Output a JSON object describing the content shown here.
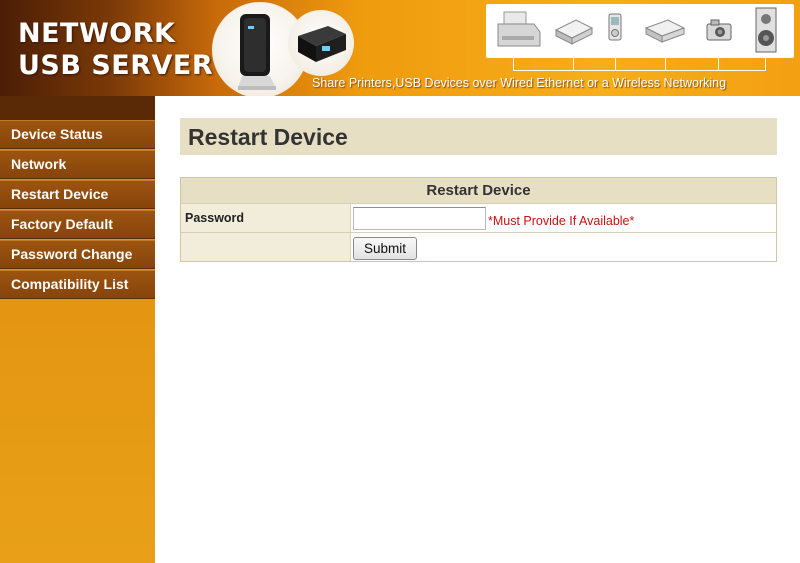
{
  "header": {
    "brand_line1": "NETWORK",
    "brand_line2": "USB SERVER",
    "tagline": "Share Printers,USB Devices over Wired Ethernet or a Wireless Networking",
    "device_icons": [
      "printer-icon",
      "scanner-icon",
      "media-player-icon",
      "external-drive-icon",
      "camera-icon",
      "speaker-icon"
    ]
  },
  "sidebar": {
    "items": [
      {
        "label": "Device Status"
      },
      {
        "label": "Network"
      },
      {
        "label": "Restart Device"
      },
      {
        "label": "Factory Default"
      },
      {
        "label": "Password Change"
      },
      {
        "label": "Compatibility List"
      }
    ]
  },
  "main": {
    "page_title": "Restart Device",
    "form": {
      "heading": "Restart Device",
      "password_label": "Password",
      "password_value": "",
      "must_provide_text": "*Must Provide If Available*",
      "submit_label": "Submit"
    }
  },
  "colors": {
    "accent": "#ef9b0e",
    "sidebar_item": "#8f4b0d",
    "panel_tan": "#e6dfc3",
    "warning_red": "#cc1111"
  }
}
